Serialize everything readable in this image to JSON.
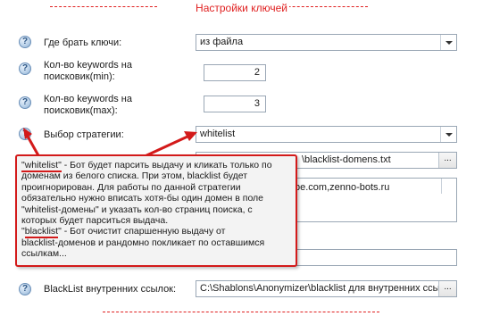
{
  "section": {
    "title": "Настройки ключей"
  },
  "rows": {
    "key_source": {
      "label": "Где брать ключи:",
      "value": "из файла"
    },
    "keywords_min": {
      "label_line1": "Кол-во keywords на",
      "label_line2": "поисковик(min):",
      "value": "2"
    },
    "keywords_max": {
      "label_line1": "Кол-во keywords на",
      "label_line2": "поисковик(max):",
      "value": "3"
    },
    "strategy": {
      "label": "Выбор стратегии:",
      "value": "whitelist"
    },
    "blacklist_path": {
      "value": "\\blacklist-domens.txt"
    },
    "domains_list": {
      "value": "be.com,zenno-bots.ru"
    },
    "internal_links": {
      "label": "BlackList внутренних ссылок:",
      "value": "C:\\Shablons\\Anonymizer\\blacklist для внутренних ссыл"
    }
  },
  "buttons": {
    "browse": "..."
  },
  "icons": {
    "help": "?"
  },
  "tooltip": {
    "l1_word": "\"whitelist\"",
    "l1_rest": " - Бот будет парсить выдачу и кликать только по",
    "l2": "доменам из белого списка. При этом, blacklist будет",
    "l3": "проигнорирован. Для работы по данной стратегии",
    "l4": "обязательно нужно вписать хотя-бы один домен в поле",
    "l5": "\"whitelist-домены\" и указать кол-во страниц поиска, с",
    "l6": "которых будет парситься выдача.",
    "l7_q1": "\"",
    "l7_word": "blacklist",
    "l7_rest": "\" - Бот очистит спаршенную выдачу от",
    "l8": "blacklist-доменов и рандомно покликает по оставшимся",
    "l9": "ссылкам..."
  },
  "colors": {
    "accent": "#e02020",
    "tooltip_border": "#d31a1a",
    "tooltip_bg": "#f3f3f3"
  }
}
